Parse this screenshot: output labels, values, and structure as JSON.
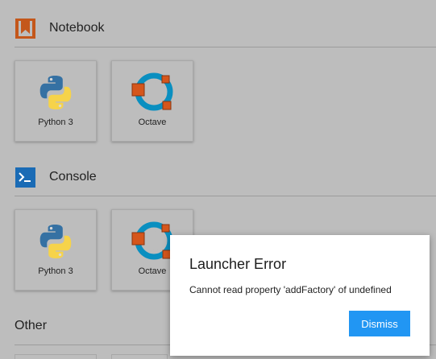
{
  "launcher": {
    "sections": [
      {
        "title": "Notebook",
        "icon": "notebook-icon",
        "icon_color": "#c4571b",
        "cards": [
          {
            "label": "Python 3",
            "icon": "python-logo-icon"
          },
          {
            "label": "Octave",
            "icon": "octave-logo-icon"
          }
        ]
      },
      {
        "title": "Console",
        "icon": "console-icon",
        "icon_color": "#1a6bb5",
        "cards": [
          {
            "label": "Python 3",
            "icon": "python-logo-icon"
          },
          {
            "label": "Octave",
            "icon": "octave-logo-icon"
          }
        ]
      },
      {
        "title": "Other",
        "cards": []
      }
    ]
  },
  "dialog": {
    "title": "Launcher Error",
    "message": "Cannot read property 'addFactory' of undefined",
    "dismiss_label": "Dismiss",
    "button_color": "#2196f3"
  },
  "colors": {
    "overlay_background": "#bdbdbd",
    "python_blue": "#3571a3",
    "python_yellow": "#f6d34a",
    "octave_blue": "#0a8fc0",
    "octave_orange": "#d5561c"
  }
}
